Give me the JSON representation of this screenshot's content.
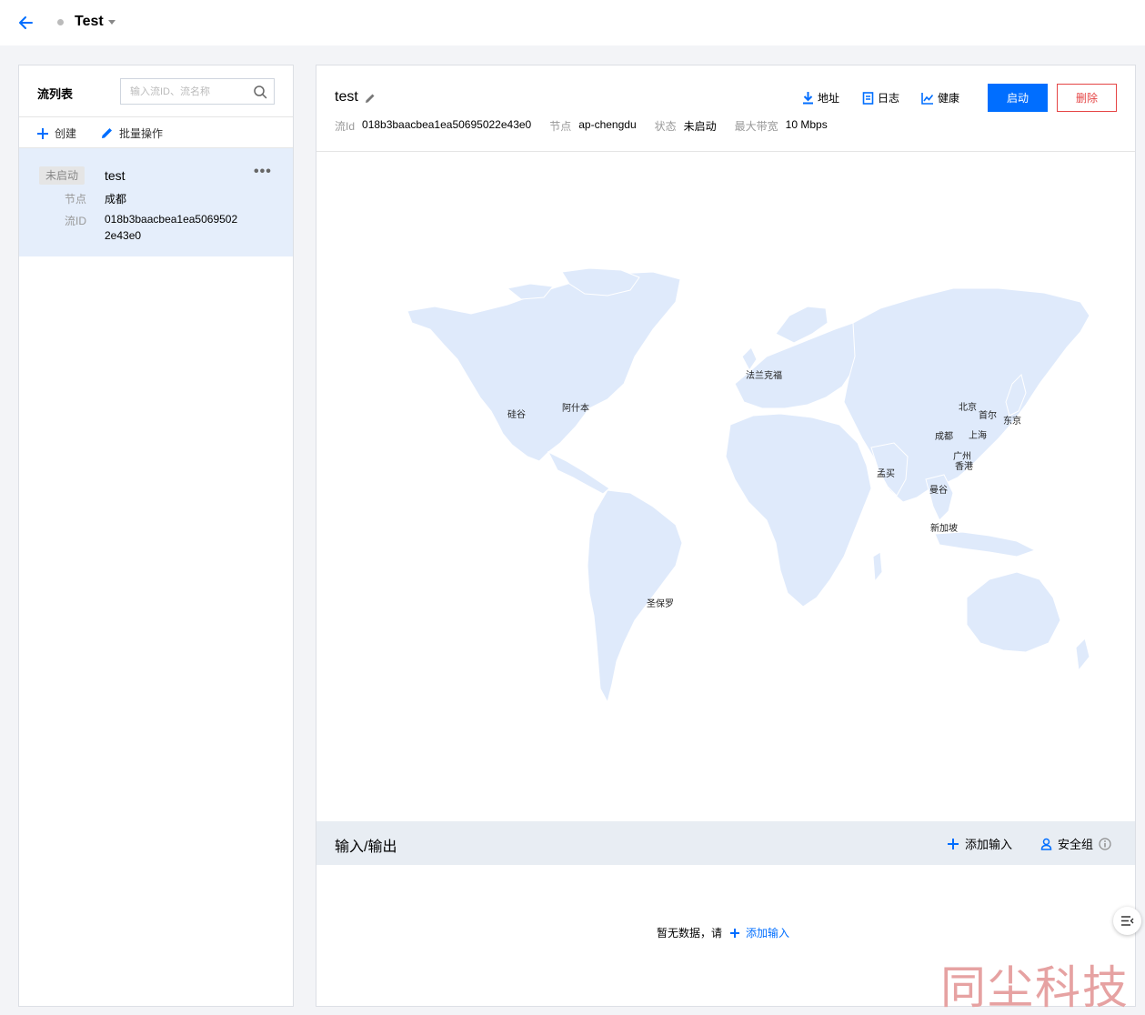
{
  "topbar": {
    "title": "Test"
  },
  "sidebar": {
    "title": "流列表",
    "search_placeholder": "输入流ID、流名称",
    "create_label": "创建",
    "batch_label": "批量操作",
    "flows": [
      {
        "status": "未启动",
        "name": "test",
        "node_label": "节点",
        "node_value": "成都",
        "flowid_label": "流ID",
        "flowid_value": "018b3baacbea1ea50695022e43e0",
        "more": "•••"
      }
    ]
  },
  "main": {
    "title": "test",
    "meta": {
      "flowid_label": "流Id",
      "flowid_value": "018b3baacbea1ea50695022e43e0",
      "node_label": "节点",
      "node_value": "ap-chengdu",
      "status_label": "状态",
      "status_value": "未启动",
      "bandwidth_label": "最大带宽",
      "bandwidth_value": "10 Mbps"
    },
    "links": {
      "address": "地址",
      "log": "日志",
      "health": "健康"
    },
    "buttons": {
      "start": "启动",
      "delete": "删除"
    },
    "map": {
      "cities": [
        "法兰克福",
        "硅谷",
        "阿什本",
        "北京",
        "首尔",
        "东京",
        "成都",
        "上海",
        "广州",
        "香港",
        "孟买",
        "曼谷",
        "新加坡",
        "圣保罗"
      ]
    },
    "io": {
      "title": "输入/输出",
      "add_input": "添加输入",
      "security_group": "安全组",
      "empty_text": "暂无数据，请",
      "empty_link": "添加输入"
    }
  },
  "watermark": "同尘科技",
  "colors": {
    "accent": "#006eff",
    "danger": "#e54545",
    "map_land": "#dfeafb",
    "selected_row": "#e5eefb"
  }
}
